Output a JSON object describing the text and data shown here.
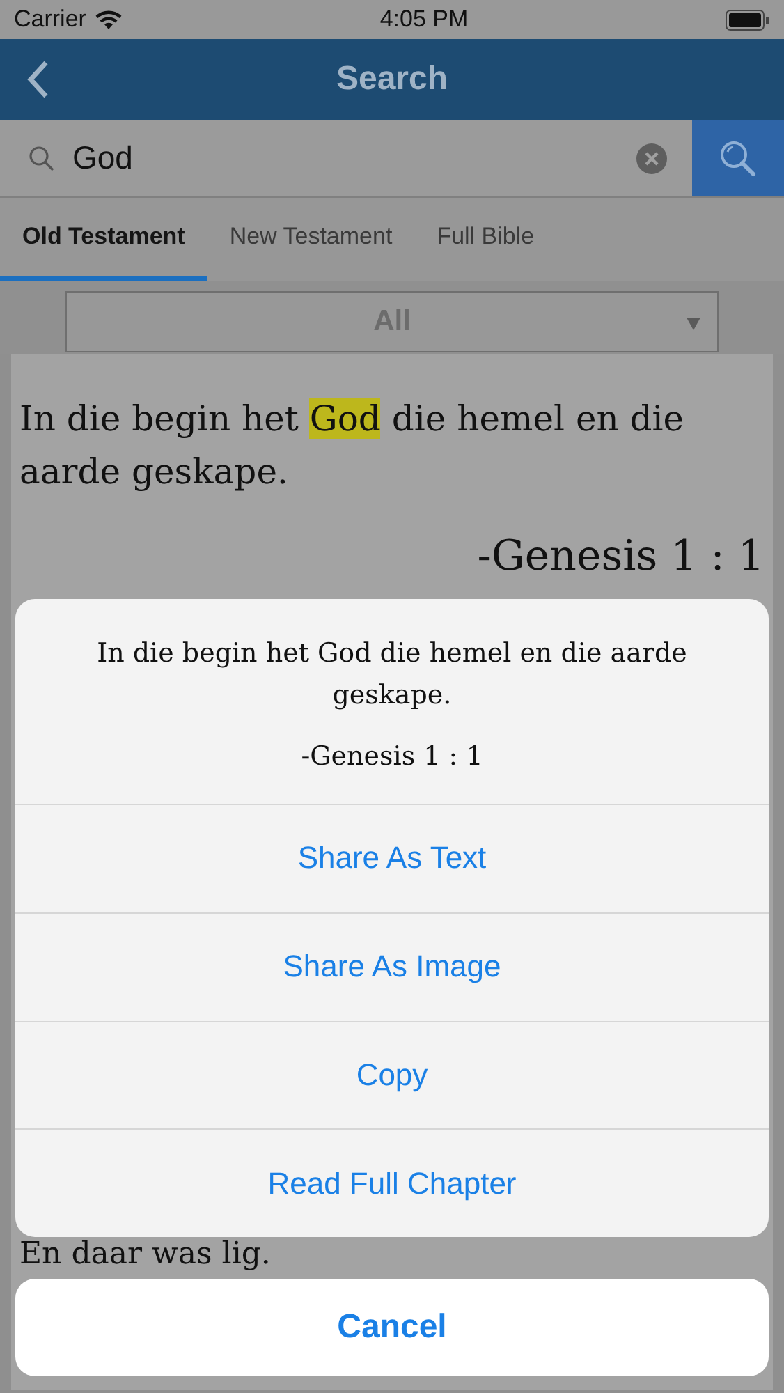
{
  "status_bar": {
    "carrier": "Carrier",
    "time": "4:05 PM"
  },
  "nav": {
    "title": "Search"
  },
  "search": {
    "value": "God"
  },
  "tabs": [
    {
      "label": "Old Testament",
      "selected": true
    },
    {
      "label": "New Testament",
      "selected": false
    },
    {
      "label": "Full Bible",
      "selected": false
    }
  ],
  "filter": {
    "value": "All"
  },
  "results": [
    {
      "before": "In die begin het ",
      "highlight": "God",
      "after": " die hemel en die aarde geskape.",
      "reference": "-Genesis 1 : 1"
    },
    {
      "before": "En daar was lig."
    }
  ],
  "action_sheet": {
    "message": "In die begin het God die hemel en die aarde geskape.",
    "reference": "-Genesis 1 : 1",
    "actions": [
      "Share As Text",
      "Share As Image",
      "Copy",
      "Read Full Chapter"
    ],
    "cancel": "Cancel"
  }
}
